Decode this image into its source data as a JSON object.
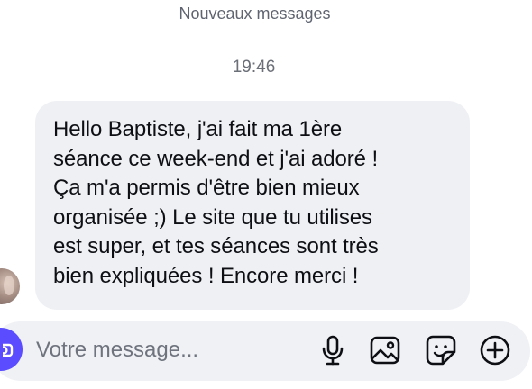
{
  "divider": {
    "label": "Nouveaux messages"
  },
  "thread": {
    "timestamp": "19:46",
    "messages": [
      {
        "direction": "incoming",
        "text": "Hello Baptiste, j'ai fait ma 1ère\nséance ce week-end et j'ai adoré !\nÇa m'a permis d'être bien mieux\norganisée ;) Le site que tu utilises\nest super, et tes séances sont très\nbien expliquées ! Encore merci !"
      }
    ]
  },
  "composer": {
    "placeholder": "Votre message...",
    "icons": {
      "camera": "camera-icon",
      "mic": "microphone-icon",
      "image": "image-icon",
      "sticker": "sticker-icon",
      "plus": "plus-circle-icon"
    }
  },
  "colors": {
    "accent": "#5b4dff",
    "bubble_background": "#eff0f4",
    "composer_background": "#f0f1f5",
    "text": "#0d0f14",
    "muted_text": "#6e737d"
  }
}
